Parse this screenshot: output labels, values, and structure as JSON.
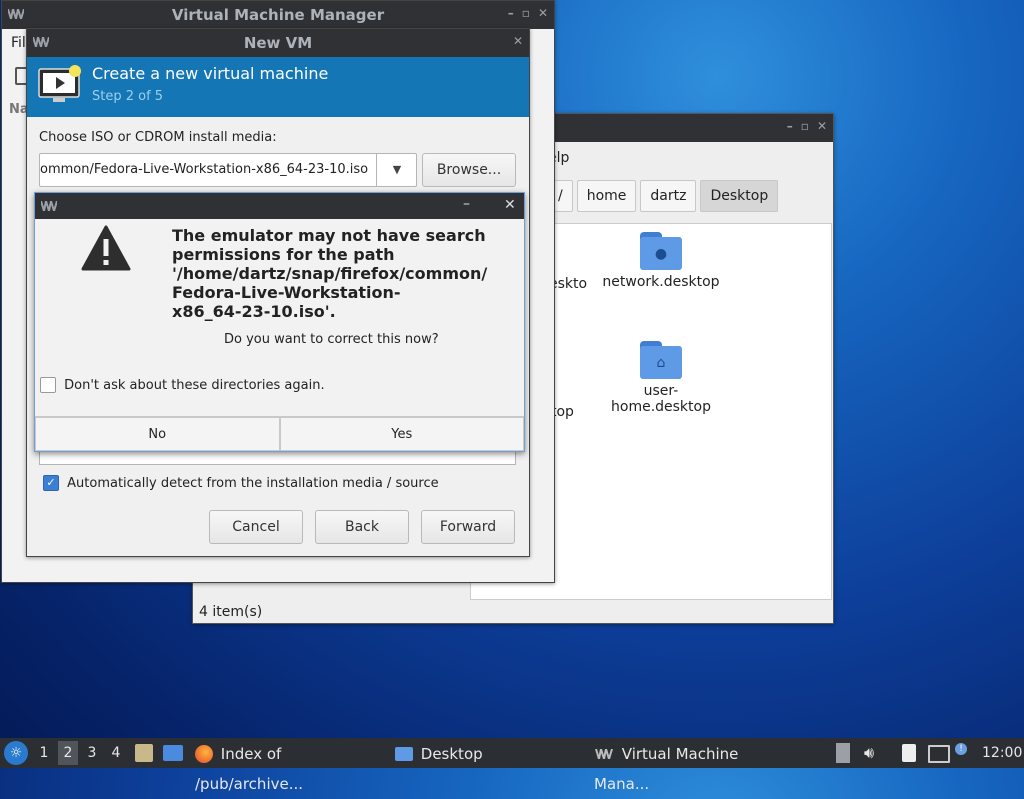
{
  "vmm": {
    "title": "Virtual Machine Manager",
    "menu_fragment": "Fil",
    "label_fragment": "Na"
  },
  "file_manager": {
    "menu_fragment": "elp",
    "breadcrumbs": [
      "/",
      "home",
      "dartz",
      "Desktop"
    ],
    "items": [
      {
        "label_fragment": "eskto"
      },
      {
        "label": "network.desktop",
        "icon": "globe-icon"
      },
      {
        "label_fragment": "top"
      },
      {
        "label_line1": "user-",
        "label_line2": "home.desktop",
        "icon": "home-icon"
      }
    ],
    "status": "4 item(s)"
  },
  "new_vm": {
    "title": "New VM",
    "header_title": "Create a new virtual machine",
    "step": "Step 2 of 5",
    "media_label": "Choose ISO or CDROM install media:",
    "iso_path": "ommon/Fedora-Live-Workstation-x86_64-23-10.iso",
    "browse_label": "Browse...",
    "auto_detect_label": "Automatically detect from the installation media / source",
    "cancel_label": "Cancel",
    "back_label": "Back",
    "forward_label": "Forward"
  },
  "dialog": {
    "message_lines": [
      "The emulator may not have search",
      "permissions for the path",
      "'/home/dartz/snap/firefox/common/",
      "Fedora-Live-Workstation-",
      "x86_64-23-10.iso'."
    ],
    "question": "Do you want to correct this now?",
    "checkbox_label": "Don't ask about these directories again.",
    "no_label": "No",
    "yes_label": "Yes",
    "minimize_glyph": "–",
    "close_glyph": "✕"
  },
  "taskbar": {
    "workspaces": [
      "1",
      "2",
      "3",
      "4"
    ],
    "active_workspace": "2",
    "tasks": [
      {
        "label": "Index of /pub/archive...",
        "icon": "firefox-icon"
      },
      {
        "label": "Desktop",
        "icon": "folder-icon"
      },
      {
        "label": "Virtual Machine Mana...",
        "icon": "vm-icon"
      }
    ],
    "clock": "12:00"
  },
  "colors": {
    "accent": "#1476b5",
    "titlebar": "#2f3135",
    "taskbar": "#2b2e33"
  }
}
